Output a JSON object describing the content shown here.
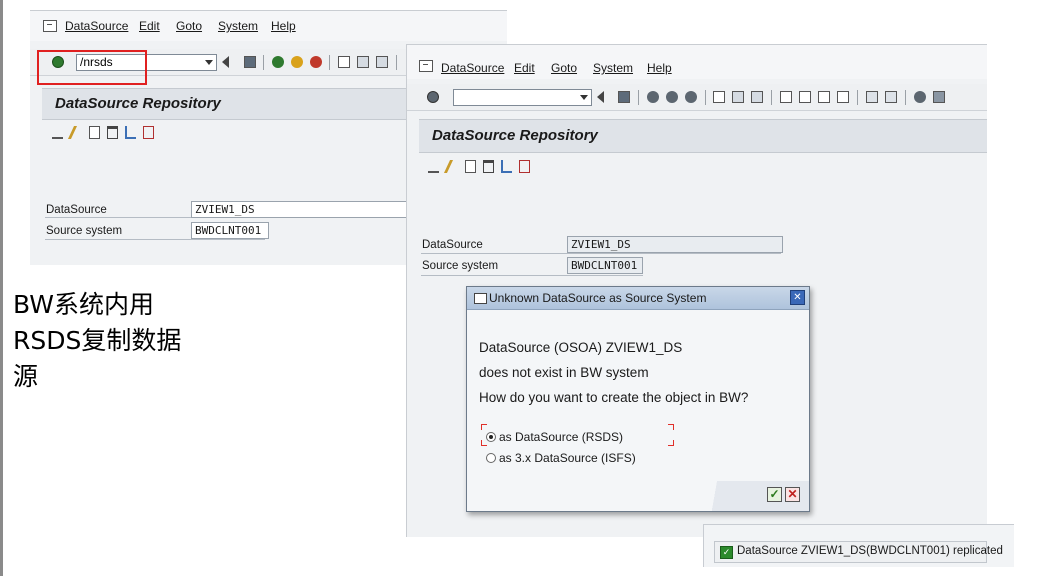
{
  "caption": {
    "lines": [
      "BW系统内用",
      "RSDS复制数据",
      "源"
    ]
  },
  "menu": {
    "datasource": "DataSource",
    "edit": "Edit",
    "goto": "Goto",
    "system": "System",
    "help": "Help"
  },
  "window_left": {
    "command_field_value": "/nrsds",
    "title": "DataSource Repository",
    "fields": [
      {
        "label": "DataSource",
        "value": "ZVIEW1_DS"
      },
      {
        "label": "Source system",
        "value": "BWDCLNT001"
      }
    ]
  },
  "window_right": {
    "command_field_value": "",
    "title": "DataSource Repository",
    "fields": [
      {
        "label": "DataSource",
        "value": "ZVIEW1_DS"
      },
      {
        "label": "Source system",
        "value": "BWDCLNT001"
      }
    ]
  },
  "dialog": {
    "title": "Unknown DataSource as Source System",
    "message_lines": [
      "DataSource (OSOA) ZVIEW1_DS",
      "does not exist in BW system",
      "How do you want to create the object in BW?"
    ],
    "options": [
      {
        "label": "as DataSource (RSDS)",
        "selected": true
      },
      {
        "label": "as 3.x DataSource (ISFS)",
        "selected": false
      }
    ]
  },
  "status_bar": {
    "message": "DataSource ZVIEW1_DS(BWDCLNT001) replicated",
    "type": "success"
  },
  "colors": {
    "highlight": "#e02020",
    "title_bar": "#dfe3e8",
    "dialog_header": "#aec3dc",
    "success": "#2c8a2c"
  }
}
